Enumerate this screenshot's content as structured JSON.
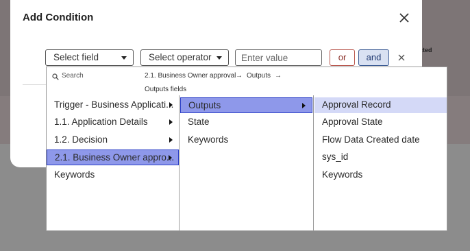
{
  "modal": {
    "title": "Add Condition",
    "behind_text": "cted"
  },
  "condition_row": {
    "field_select": "Select field",
    "operator_select": "Select operator",
    "value_placeholder": "Enter value",
    "or_label": "or",
    "and_label": "and"
  },
  "dropdown": {
    "search_label": "Search",
    "breadcrumb": [
      "2.1. Business Owner approval",
      "Outputs",
      "Outputs fields"
    ],
    "column1": [
      {
        "label": "Trigger - Business Applicati...",
        "has_children": true
      },
      {
        "label": "1.1. Application Details",
        "has_children": true
      },
      {
        "label": "1.2. Decision",
        "has_children": true
      },
      {
        "label": "2.1. Business Owner appro...",
        "has_children": true,
        "selected": true
      },
      {
        "label": "Keywords",
        "has_children": false
      }
    ],
    "column2": [
      {
        "label": "Outputs",
        "has_children": true,
        "selected": true
      },
      {
        "label": "State",
        "has_children": false
      },
      {
        "label": "Keywords",
        "has_children": false
      }
    ],
    "column3": [
      {
        "label": "Approval Record",
        "highlighted": true
      },
      {
        "label": "Approval State"
      },
      {
        "label": "Flow Data Created date"
      },
      {
        "label": "sys_id"
      },
      {
        "label": "Keywords"
      }
    ]
  },
  "colors": {
    "selected_bg": "#8e98ea",
    "selected_border": "#2a3ec6",
    "hover_bg": "#d4d9f7",
    "and_bg": "#d9e1f2",
    "or_border": "#b8574e"
  }
}
